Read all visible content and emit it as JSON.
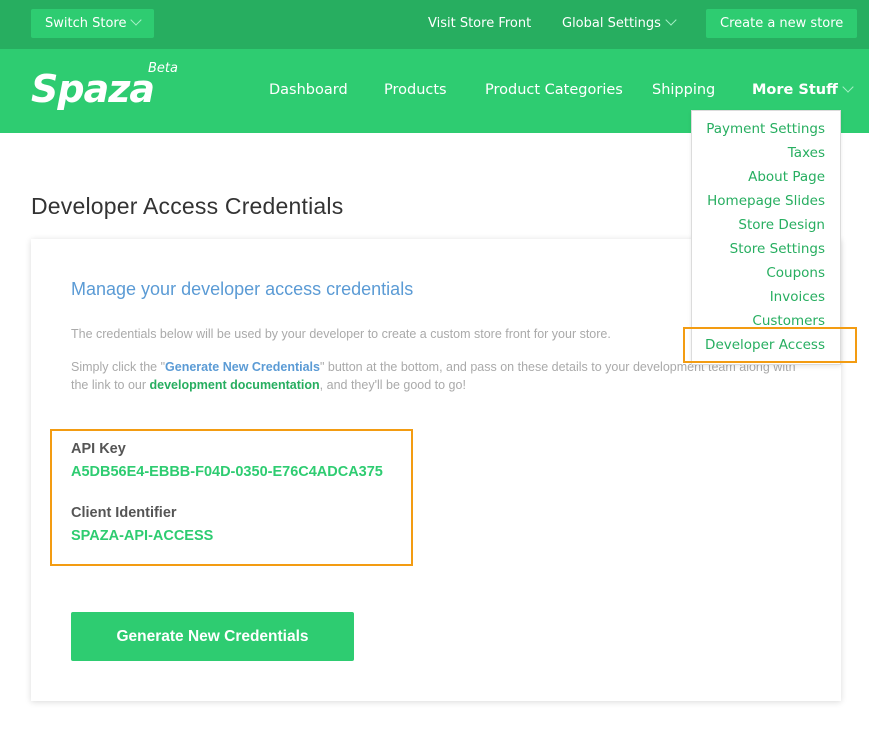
{
  "topbar": {
    "switch_store": "Switch Store",
    "visit_store_front": "Visit Store Front",
    "global_settings": "Global Settings",
    "create_store": "Create a new store"
  },
  "brand": {
    "logo": "Spaza",
    "badge": "Beta"
  },
  "nav": {
    "dashboard": "Dashboard",
    "products": "Products",
    "product_categories": "Product Categories",
    "shipping": "Shipping",
    "more_stuff": "More Stuff"
  },
  "more_menu": {
    "items": [
      "Payment Settings",
      "Taxes",
      "About Page",
      "Homepage Slides",
      "Store Design",
      "Store Settings",
      "Coupons",
      "Invoices",
      "Customers",
      "Developer Access"
    ]
  },
  "page": {
    "title": "Developer Access Credentials"
  },
  "card": {
    "heading": "Manage your developer access credentials",
    "intro": "The credentials below will be used by your developer to create a custom store front for your store.",
    "instructions_prefix": "Simply click the \"",
    "instructions_button_ref": "Generate New Credentials",
    "instructions_middle": "\" button at the bottom, and pass on these details to your development team along with the link to our ",
    "instructions_link": "development documentation",
    "instructions_suffix": ", and they'll be good to go!"
  },
  "credentials": {
    "api_key_label": "API Key",
    "api_key_value": "A5DB56E4-EBBB-F04D-0350-E76C4ADCA375",
    "client_id_label": "Client Identifier",
    "client_id_value": "SPAZA-API-ACCESS"
  },
  "actions": {
    "generate": "Generate New Credentials"
  },
  "colors": {
    "brand_green": "#2ecc71",
    "topbar_green": "#27ae60",
    "heading_blue": "#5b9bd5",
    "highlight_orange": "#f39c12"
  }
}
